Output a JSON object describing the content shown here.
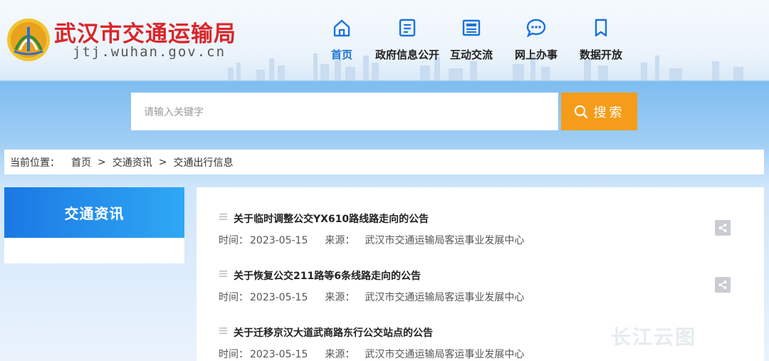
{
  "header": {
    "site_title": "武汉市交通运输局",
    "site_domain": "jtj.wuhan.gov.cn"
  },
  "nav": {
    "items": [
      {
        "label": "首页",
        "icon": "home-icon"
      },
      {
        "label": "政府信息公开",
        "icon": "document-icon"
      },
      {
        "label": "互动交流",
        "icon": "newspaper-icon"
      },
      {
        "label": "网上办事",
        "icon": "chat-bubble-icon"
      },
      {
        "label": "数据开放",
        "icon": "bookmark-icon"
      }
    ],
    "active_color": "#1a73d9"
  },
  "search": {
    "placeholder": "请输入关键字",
    "button_label": "搜索",
    "button_color": "#f59c1a"
  },
  "breadcrumb": {
    "prefix": "当前位置：",
    "items": [
      "首页",
      "交通资讯",
      "交通出行信息"
    ],
    "separator": ">"
  },
  "sidebar": {
    "heading": "交通资讯"
  },
  "articles": [
    {
      "title": "关于临时调整公交YX610路线路走向的公告",
      "time_label": "时间：",
      "date": "2023-05-15",
      "source_label": "来源：",
      "source": "武汉市交通运输局客运事业发展中心"
    },
    {
      "title": "关于恢复公交211路等6条线路走向的公告",
      "time_label": "时间：",
      "date": "2023-05-15",
      "source_label": "来源：",
      "source": "武汉市交通运输局客运事业发展中心"
    },
    {
      "title": "关于迁移京汉大道武商路东行公交站点的公告",
      "time_label": "时间：",
      "date": "2023-05-15",
      "source_label": "来源：",
      "source": "武汉市交通运输局客运事业发展中心"
    }
  ],
  "watermark": "长江云图"
}
